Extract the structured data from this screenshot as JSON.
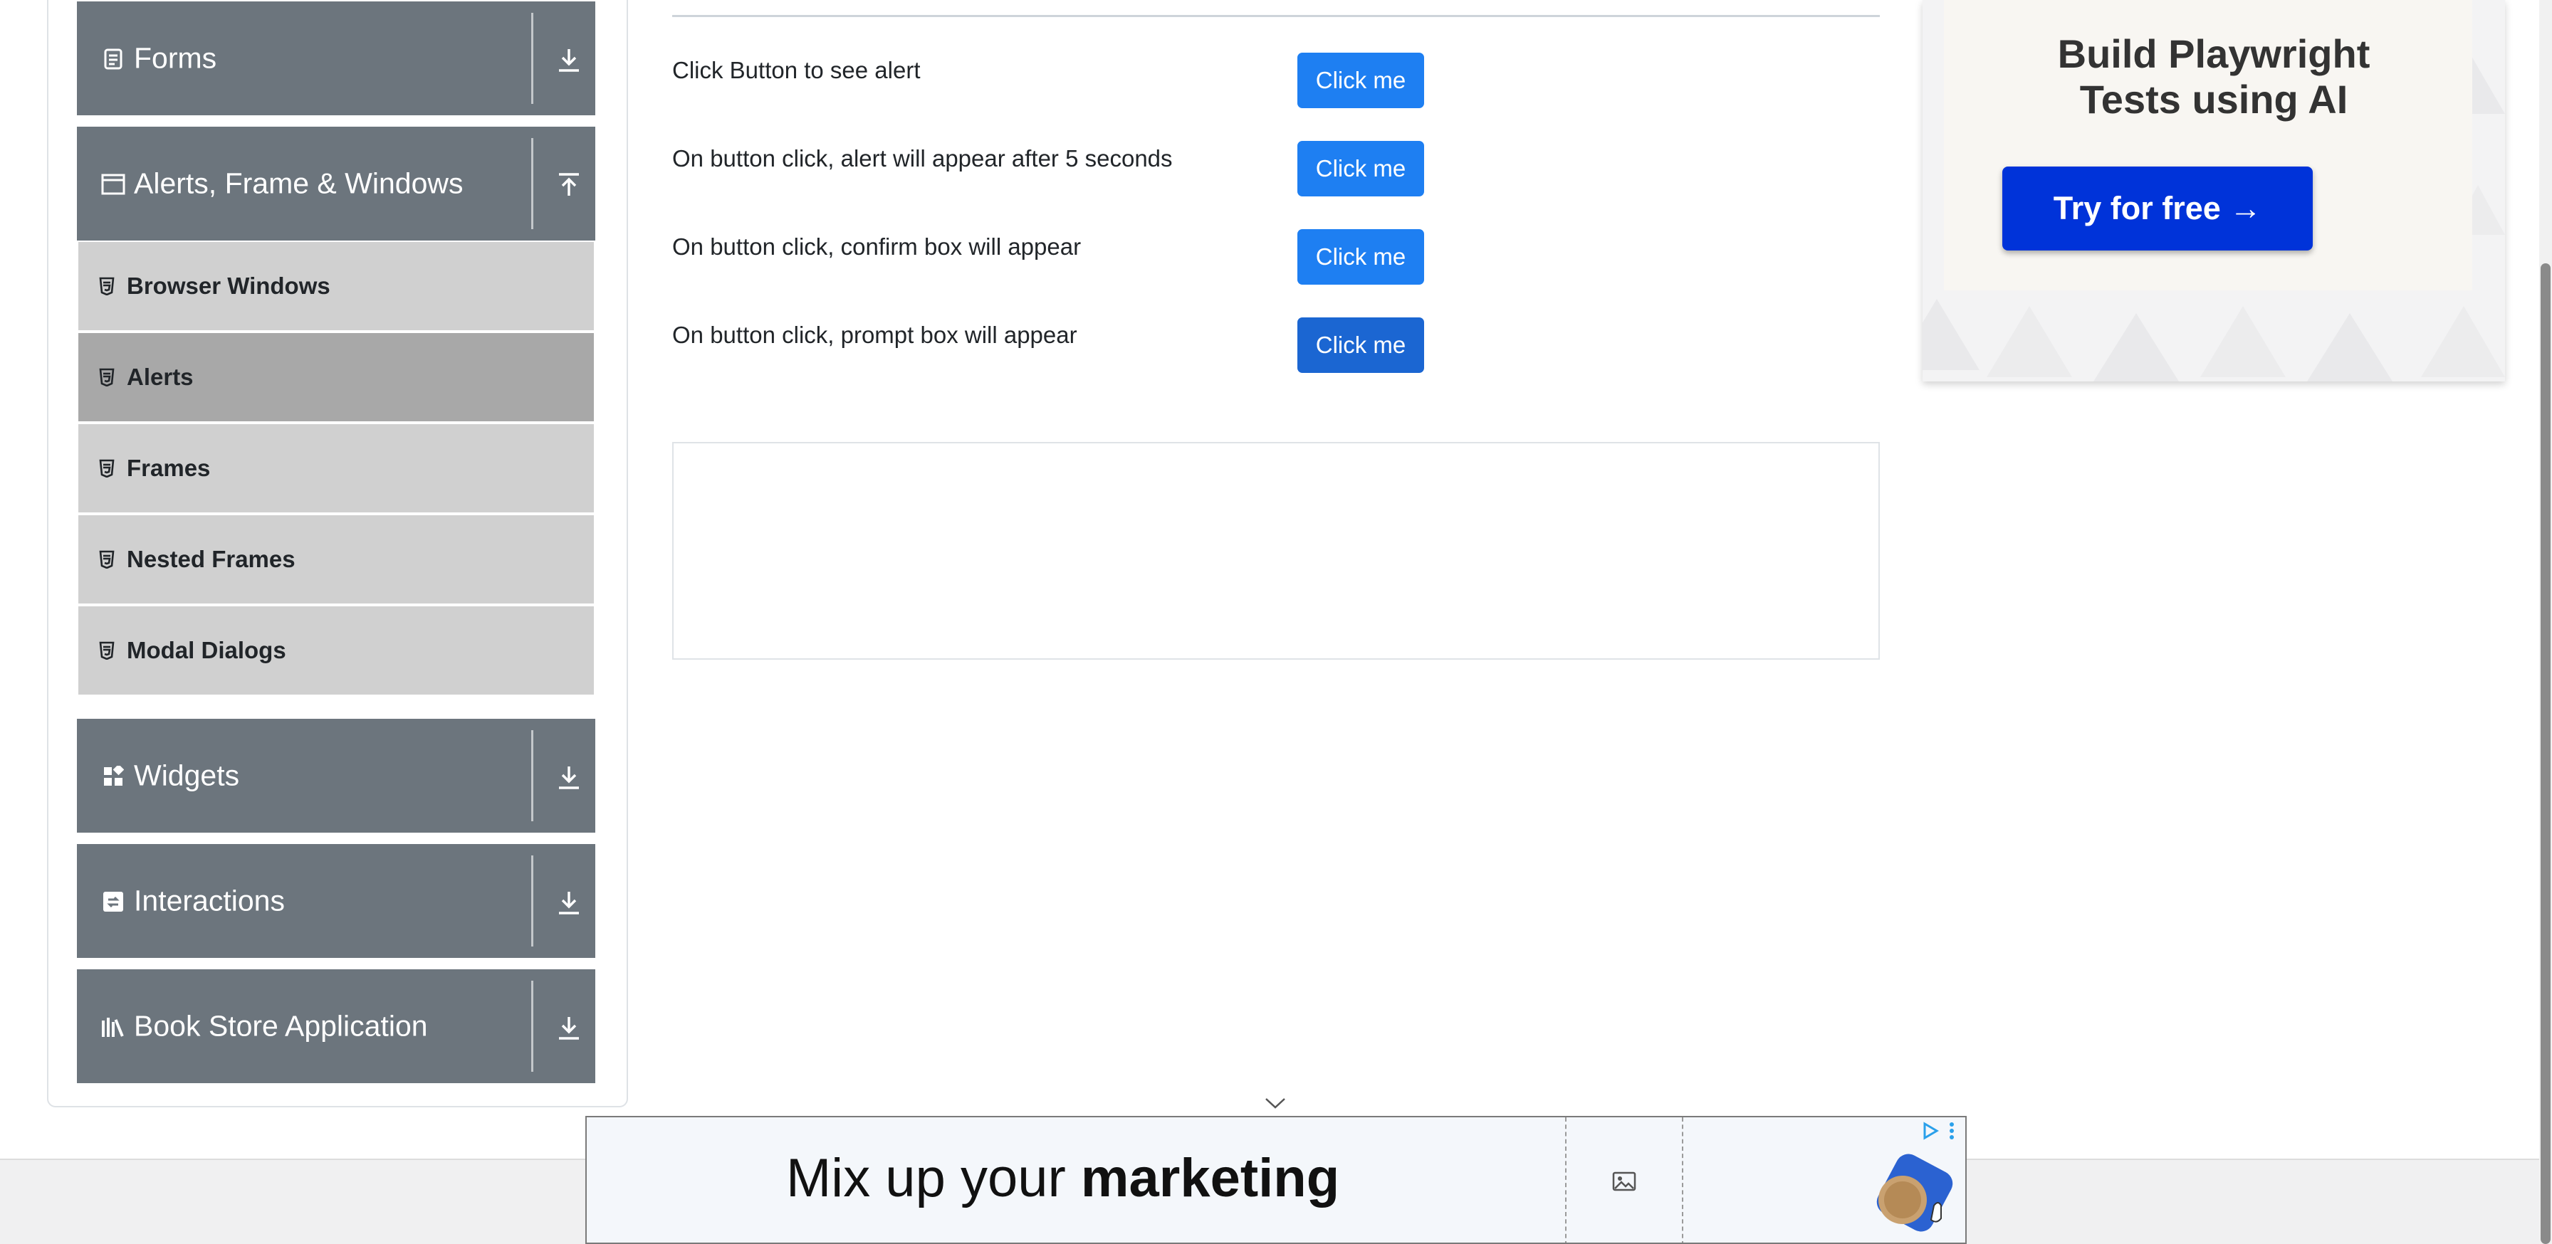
{
  "sidebar": {
    "groups": [
      {
        "label": "Forms",
        "icon": "form-icon",
        "arrow": "download-arrow-icon"
      },
      {
        "label": "Alerts, Frame & Windows",
        "icon": "window-icon",
        "arrow": "upload-arrow-icon"
      },
      {
        "label": "Widgets",
        "icon": "widgets-icon",
        "arrow": "download-arrow-icon"
      },
      {
        "label": "Interactions",
        "icon": "interactions-icon",
        "arrow": "download-arrow-icon"
      },
      {
        "label": "Book Store Application",
        "icon": "books-icon",
        "arrow": "download-arrow-icon"
      }
    ],
    "items": [
      {
        "label": "Browser Windows",
        "icon": "html5-icon"
      },
      {
        "label": "Alerts",
        "icon": "html5-icon",
        "active": true
      },
      {
        "label": "Frames",
        "icon": "html5-icon"
      },
      {
        "label": "Nested Frames",
        "icon": "html5-icon"
      },
      {
        "label": "Modal Dialogs",
        "icon": "html5-icon"
      }
    ]
  },
  "main": {
    "rows": [
      {
        "text": "Click Button to see alert",
        "button": "Click me"
      },
      {
        "text": "On button click, alert will appear after 5 seconds",
        "button": "Click me"
      },
      {
        "text": "On button click, confirm box will appear",
        "button": "Click me"
      },
      {
        "text": "On button click, prompt box will appear",
        "button": "Click me"
      }
    ]
  },
  "right_ad": {
    "line1": "Build Playwright",
    "line2": "Tests using AI",
    "cta": "Try for free →"
  },
  "bottom_ad": {
    "headline_regular": "Mix up your ",
    "headline_bold": "marketing"
  },
  "colors": {
    "sidebar_header": "#6c757d",
    "menu_item": "#d0d0d0",
    "menu_item_active": "#a8a8a8",
    "primary_button": "#1e7ff2",
    "ad_cta": "#0033d9"
  }
}
